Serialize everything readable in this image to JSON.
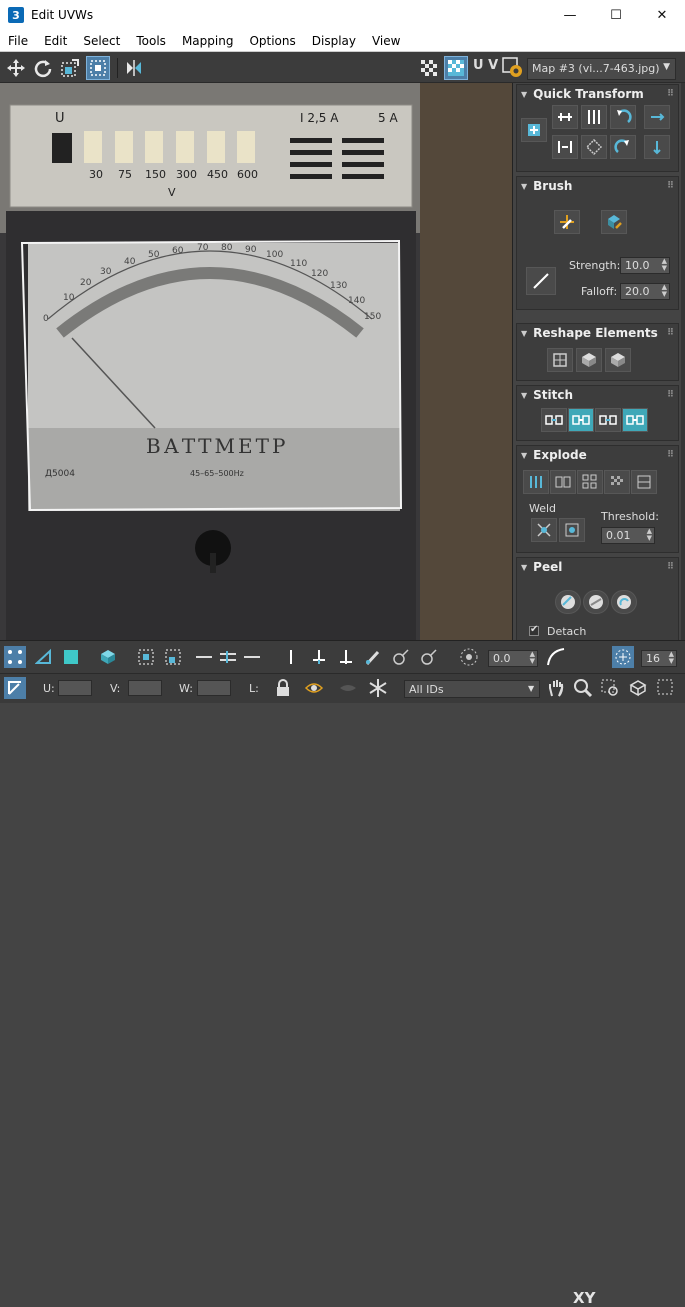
{
  "window": {
    "title": "Edit UVWs",
    "app_icon_glyph": "3",
    "minimize": "—",
    "maximize": "☐",
    "close": "✕"
  },
  "menu": [
    "File",
    "Edit",
    "Select",
    "Tools",
    "Mapping",
    "Options",
    "Display",
    "View"
  ],
  "toolbar": {
    "uv_label": "U V",
    "map_dropdown": "Map #3 (vi...7-463.jpg)"
  },
  "panels": {
    "quick_transform": {
      "title": "Quick Transform"
    },
    "brush": {
      "title": "Brush",
      "strength_label": "Strength:",
      "strength_value": "10.0",
      "falloff_label": "Falloff:",
      "falloff_value": "20.0"
    },
    "reshape": {
      "title": "Reshape Elements"
    },
    "stitch": {
      "title": "Stitch"
    },
    "explode": {
      "title": "Explode",
      "weld_label": "Weld",
      "threshold_label": "Threshold:",
      "threshold_value": "0.01"
    },
    "peel": {
      "title": "Peel",
      "detach_label": "Detach"
    }
  },
  "meter_image": {
    "scale_top_left": "U",
    "current_label": "I  2,5 A",
    "current_right": "5 A",
    "voltage_buttons": [
      "30",
      "75",
      "150",
      "300",
      "450",
      "600"
    ],
    "voltage_unit": "V",
    "dial_numbers": [
      "0",
      "10",
      "20",
      "30",
      "40",
      "50",
      "60",
      "70",
      "80",
      "90",
      "100",
      "110",
      "120",
      "130",
      "140",
      "150"
    ],
    "meter_name": "ВАТТМЕТР",
    "model": "Д5004",
    "freq": "45–65–500Hz"
  },
  "bottom_bar": {
    "spin_value": "0.0",
    "xy_label": "XY",
    "grid_value": "16"
  },
  "status_bar": {
    "u_label": "U:",
    "v_label": "V:",
    "w_label": "W:",
    "l_label": "L:",
    "ids_dropdown": "All IDs"
  }
}
